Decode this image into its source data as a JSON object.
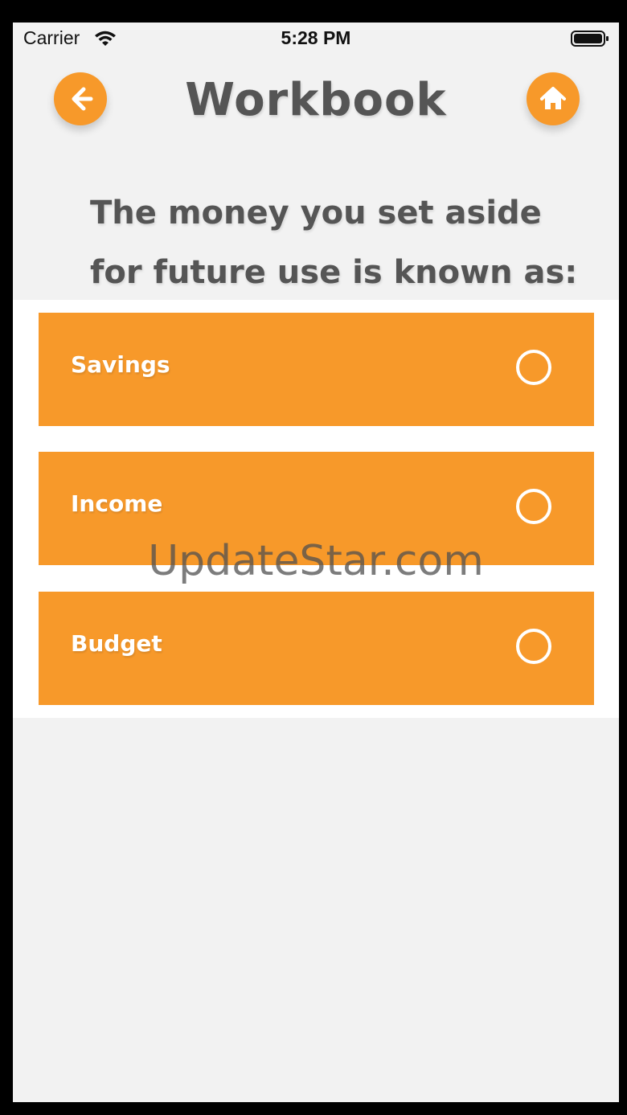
{
  "status_bar": {
    "carrier": "Carrier",
    "time": "5:28 PM",
    "icons": [
      "wifi-icon",
      "battery-icon"
    ]
  },
  "header": {
    "title": "Workbook",
    "back_icon": "arrow-left-icon",
    "home_icon": "home-icon"
  },
  "question": {
    "text": "The money you set aside for future use is known as:"
  },
  "options": [
    {
      "label": "Savings",
      "selected": false
    },
    {
      "label": "Income",
      "selected": false
    },
    {
      "label": "Budget",
      "selected": false
    }
  ],
  "watermark": "UpdateStar.com",
  "colors": {
    "accent": "#f7992a",
    "title_text": "#555555",
    "background": "#f2f2f2",
    "panel": "#ffffff"
  }
}
